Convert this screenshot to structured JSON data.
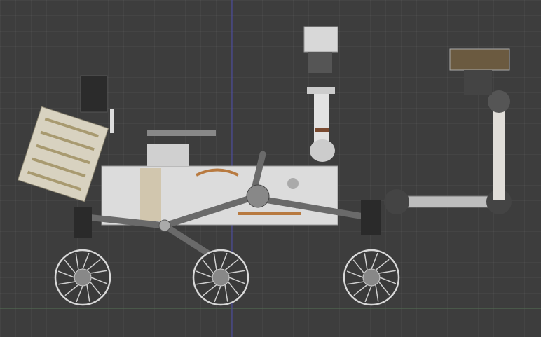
{
  "viewport": {
    "background_color": "#3d3d3d",
    "axis_z_color": "#4a4a9a",
    "axis_y_color": "#4e6b4e",
    "object": "mars-rover-model"
  }
}
